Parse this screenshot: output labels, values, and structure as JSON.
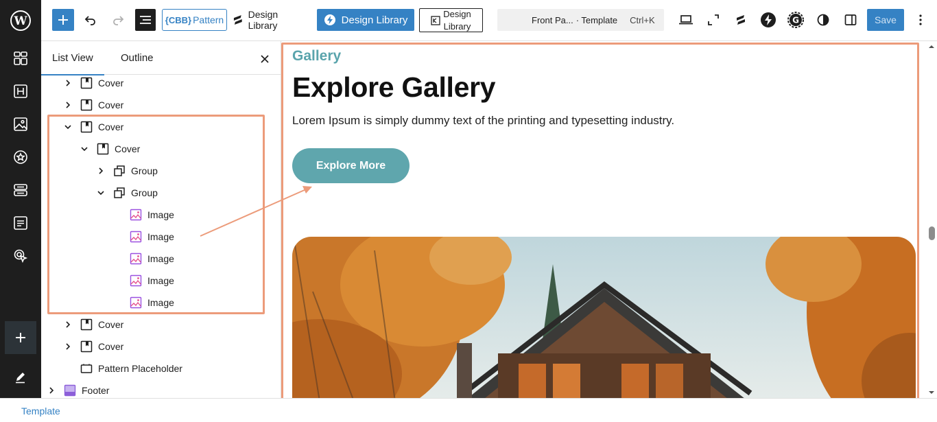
{
  "toolbar": {
    "cbb_mark": "{CBB}",
    "cbb_label": "Pattern",
    "design_library_1": "Design Library",
    "design_library_2": "Design Library",
    "design_library_3_line1": "Design",
    "design_library_3_line2": "Library",
    "command": {
      "title": "Front Pa...",
      "type": "· Template",
      "shortcut": "Ctrl+K"
    },
    "save_label": "Save"
  },
  "panel": {
    "tabs": [
      "List View",
      "Outline"
    ],
    "rows": [
      {
        "label": "Cover",
        "icon": "cover-icon",
        "expanded": false
      },
      {
        "label": "Cover",
        "icon": "cover-icon",
        "expanded": false
      },
      {
        "label": "Cover",
        "icon": "cover-icon",
        "expanded": true
      },
      {
        "label": "Cover",
        "icon": "cover-icon",
        "expanded": true
      },
      {
        "label": "Group",
        "icon": "group-icon",
        "expanded": false
      },
      {
        "label": "Group",
        "icon": "group-icon",
        "expanded": true
      },
      {
        "label": "Image",
        "icon": "image-icon"
      },
      {
        "label": "Image",
        "icon": "image-icon"
      },
      {
        "label": "Image",
        "icon": "image-icon"
      },
      {
        "label": "Image",
        "icon": "image-icon"
      },
      {
        "label": "Image",
        "icon": "image-icon"
      },
      {
        "label": "Cover",
        "icon": "cover-icon",
        "expanded": false
      },
      {
        "label": "Cover",
        "icon": "cover-icon",
        "expanded": false
      },
      {
        "label": "Pattern Placeholder",
        "icon": "pattern-placeholder-icon"
      },
      {
        "label": "Footer",
        "icon": "footer-icon",
        "expanded": false
      }
    ]
  },
  "canvas": {
    "eyebrow": "Gallery",
    "headline": "Explore Gallery",
    "lead": "Lorem Ipsum is simply dummy text of the printing and typesetting industry.",
    "cta": "Explore More"
  },
  "footer": {
    "breadcrumb": "Template"
  },
  "colors": {
    "accent": "#3582c4",
    "highlight": "#ec9b7a",
    "teal": "#5fa6ad",
    "rail": "#1e1e1e"
  }
}
